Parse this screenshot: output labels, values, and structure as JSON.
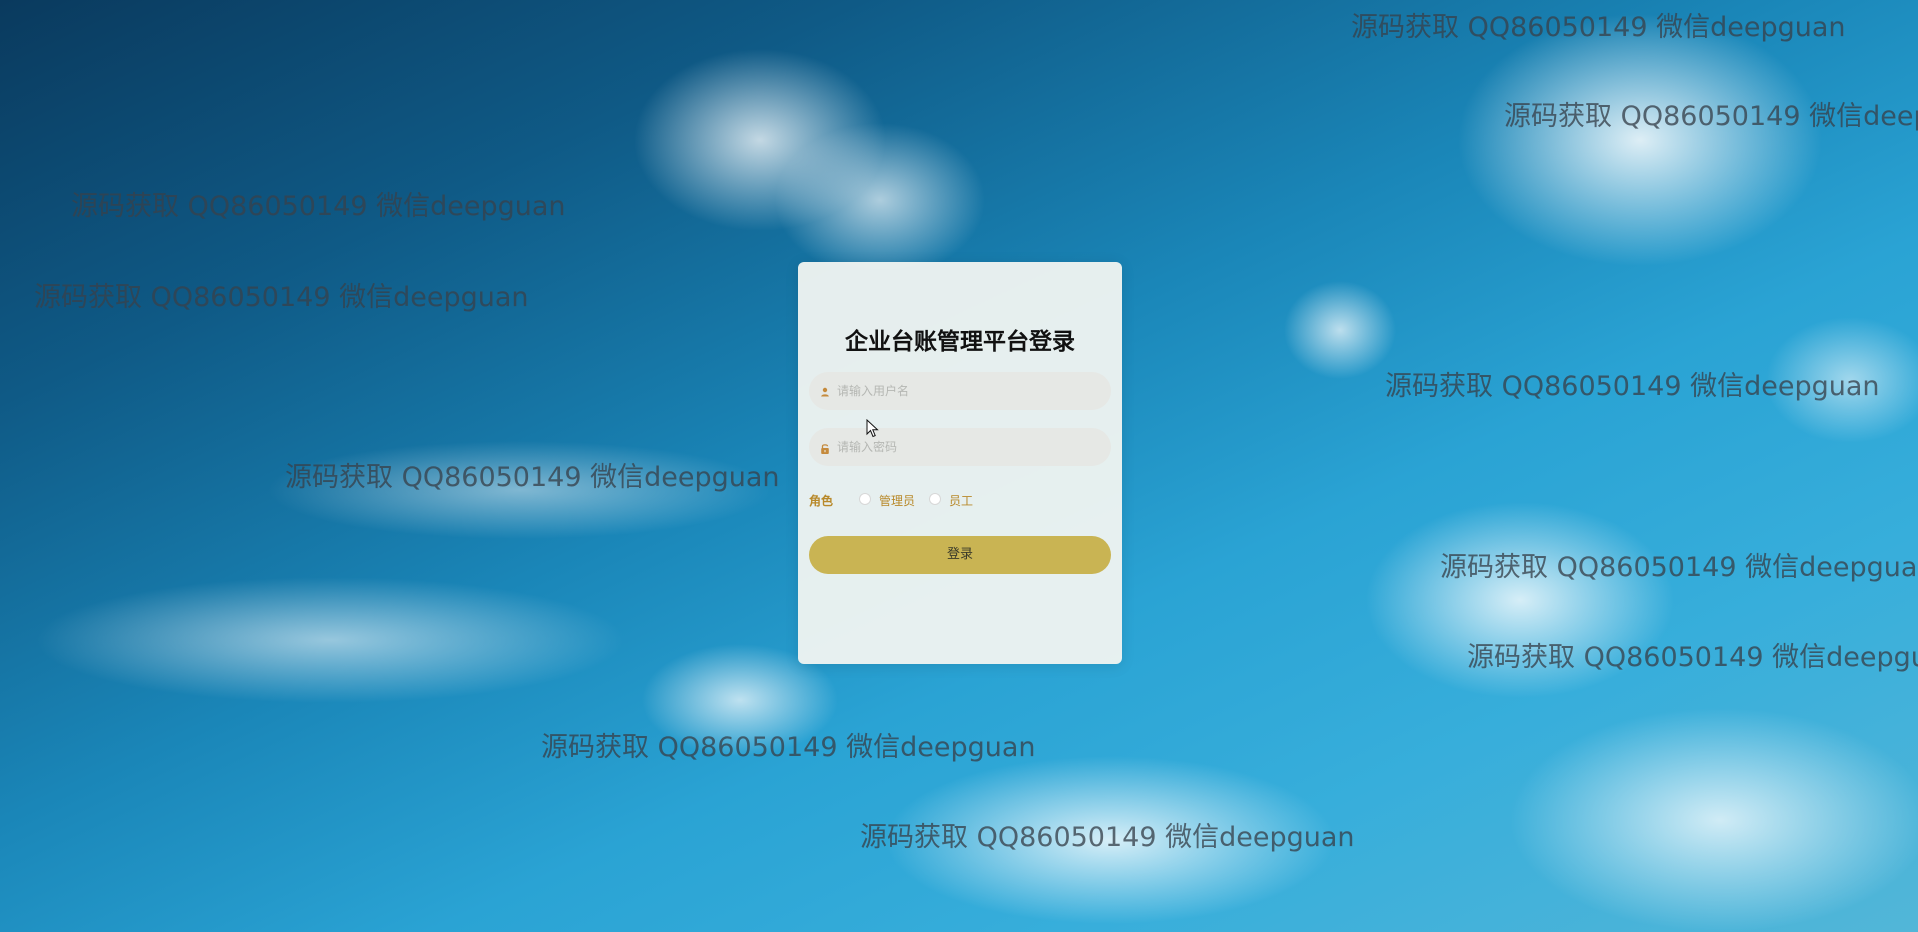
{
  "watermark_text": "源码获取 QQ86050149 微信deepguan",
  "login": {
    "title": "企业台账管理平台登录",
    "username_placeholder": "请输入用户名",
    "password_placeholder": "请输入密码",
    "role_label": "角色",
    "roles": [
      "管理员",
      "员工"
    ],
    "submit_label": "登录"
  },
  "icons": {
    "username": "user-icon",
    "password": "lock-icon",
    "pointer": "mouse-cursor-icon"
  },
  "colors": {
    "card_background": "#f1f4f1",
    "field_background": "#e6e8e5",
    "button": "#c9b453",
    "role_text": "#b8892a",
    "watermark": "#37414b"
  }
}
